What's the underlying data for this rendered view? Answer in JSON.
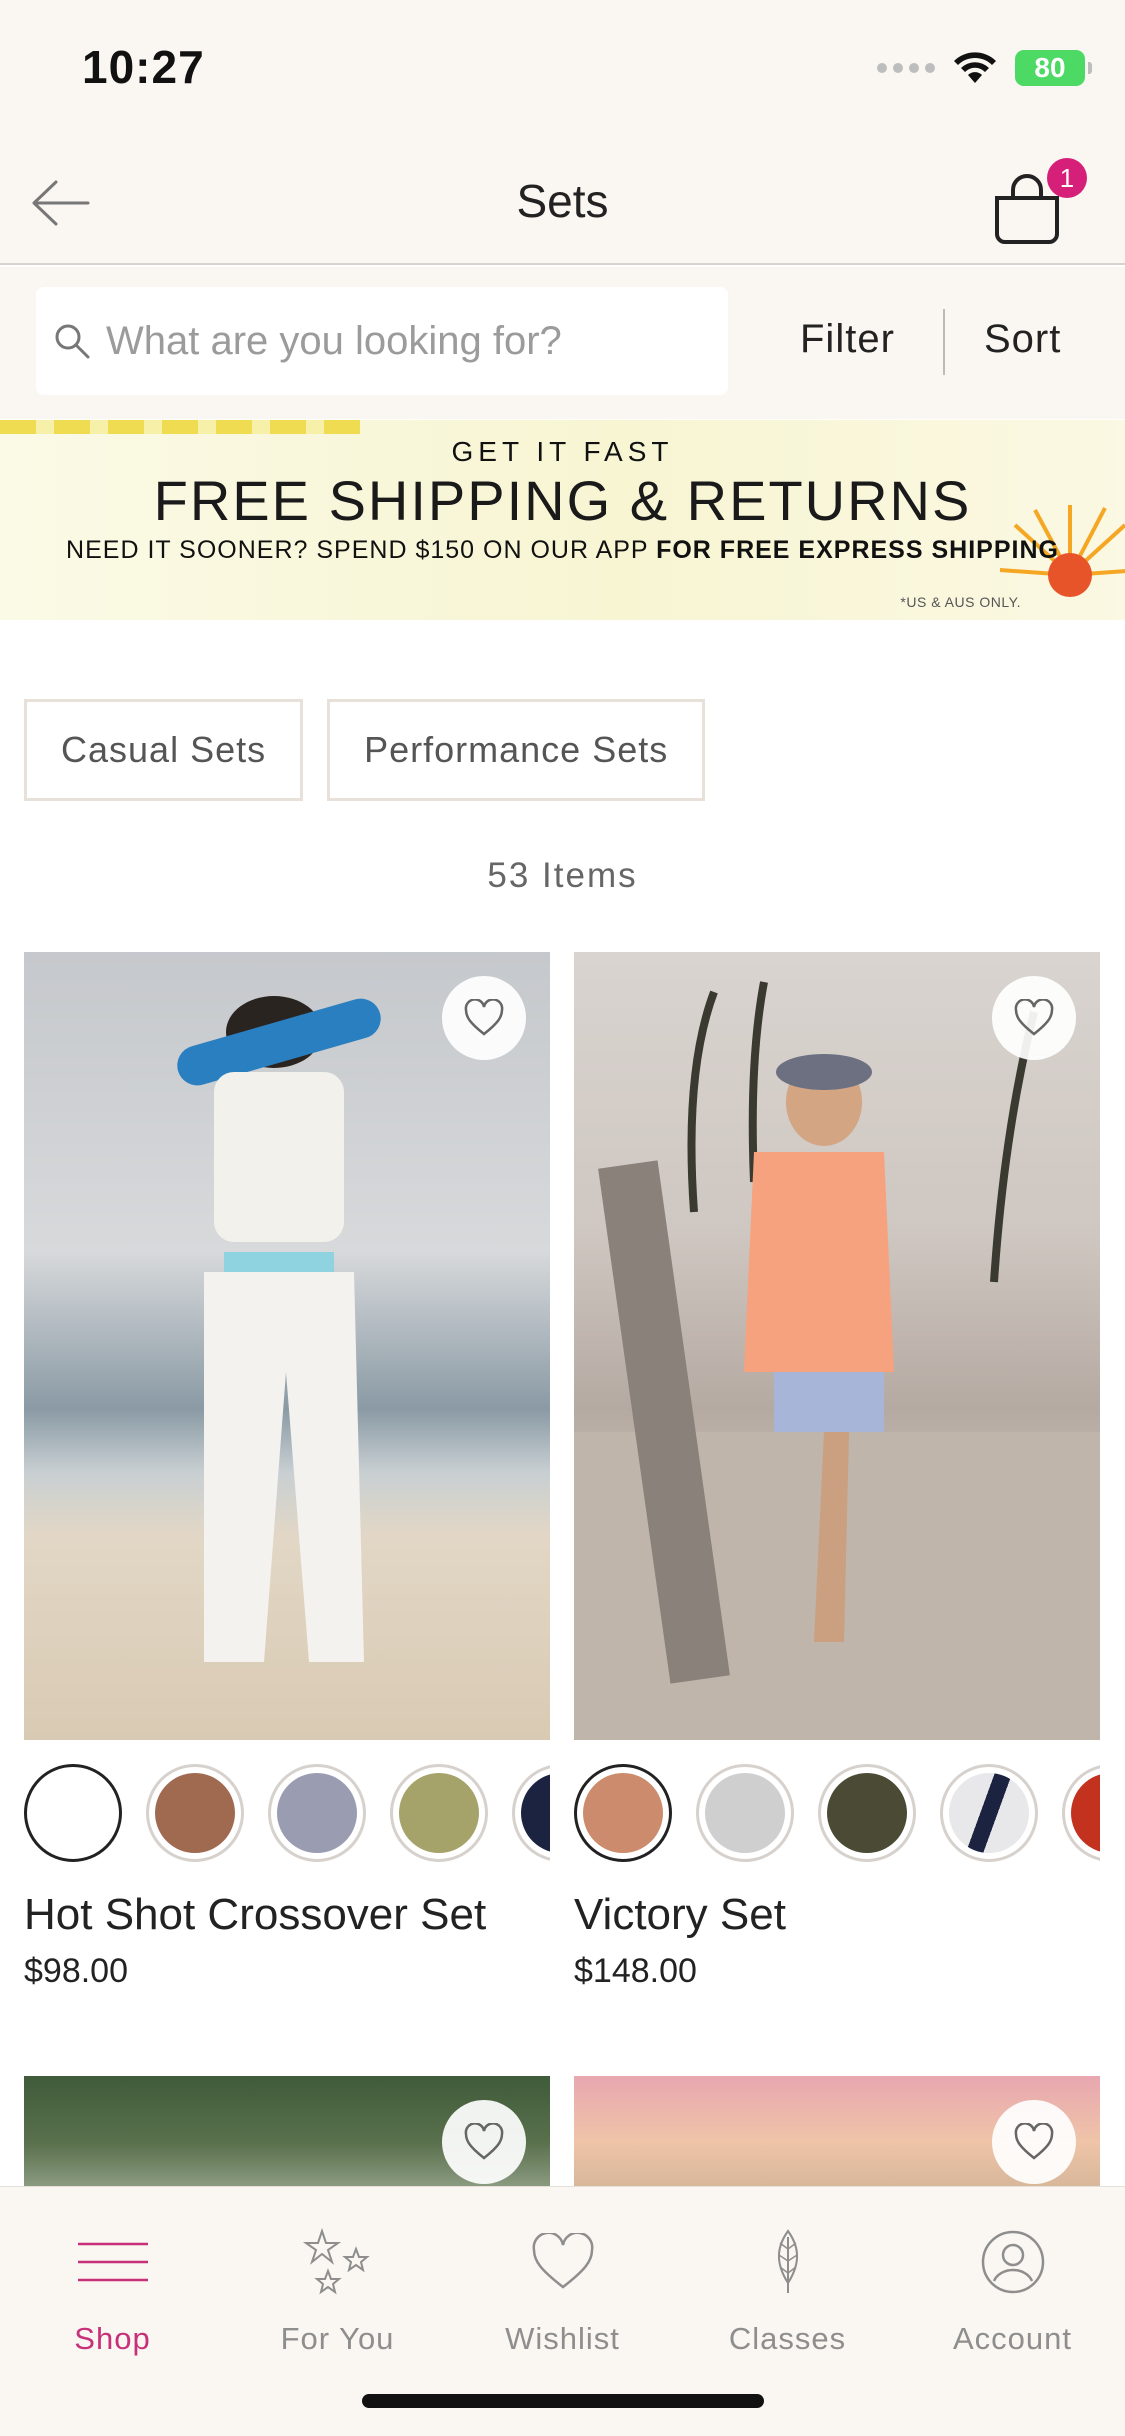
{
  "status": {
    "time": "10:27",
    "battery": "80"
  },
  "header": {
    "title": "Sets",
    "cart_count": "1"
  },
  "search": {
    "placeholder": "What are you looking for?",
    "filter_label": "Filter",
    "sort_label": "Sort"
  },
  "banner": {
    "line1": "GET IT FAST",
    "line2": "FREE SHIPPING & RETURNS",
    "line3_prefix": "NEED IT SOONER? SPEND $150 ON OUR APP ",
    "line3_bold": "FOR FREE EXPRESS SHIPPING",
    "disclaimer": "*US & AUS ONLY."
  },
  "categories": [
    "Casual Sets",
    "Performance Sets"
  ],
  "item_count": "53 Items",
  "products": [
    {
      "name": "Hot Shot Crossover Set",
      "price": "$98.00",
      "swatches": [
        "#ffffff",
        "#a06a50",
        "#9a9cb2",
        "#a5a36a",
        "#1c2340"
      ]
    },
    {
      "name": "Victory Set",
      "price": "$148.00",
      "swatches": [
        "#cc8b6c",
        "#cfcfcf",
        "#4a4a35",
        "#e8e8ea",
        "#c2321f"
      ]
    }
  ],
  "tabs": [
    {
      "label": "Shop",
      "icon": "menu-icon"
    },
    {
      "label": "For You",
      "icon": "stars-icon"
    },
    {
      "label": "Wishlist",
      "icon": "heart-icon"
    },
    {
      "label": "Classes",
      "icon": "leaf-icon"
    },
    {
      "label": "Account",
      "icon": "account-icon"
    }
  ],
  "colors": {
    "accent": "#c6317a",
    "badge": "#d61f78",
    "header_bg": "#faf6f1"
  }
}
